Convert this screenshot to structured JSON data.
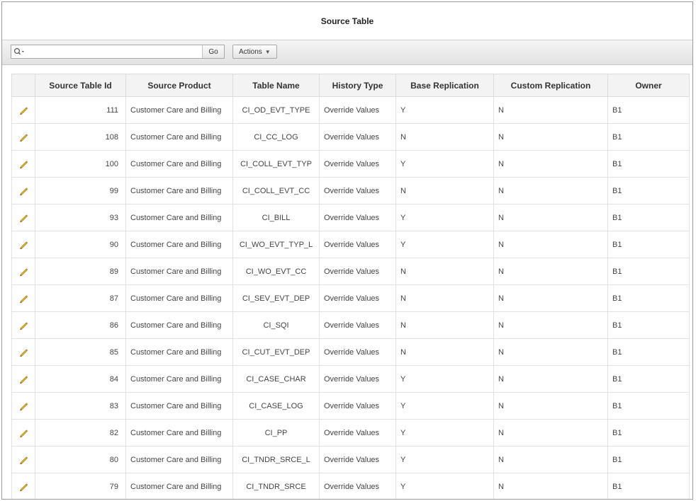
{
  "region": {
    "title": "Source Table"
  },
  "toolbar": {
    "search_value": "",
    "go_label": "Go",
    "actions_label": "Actions"
  },
  "icons": {
    "search": "search-icon",
    "edit": "pencil-icon",
    "caret": "chevron-down-icon"
  },
  "colors": {
    "toolbar_bg": "#e6e6e6",
    "header_bg": "#f3f3f3",
    "pencil": "#e3b72c"
  },
  "table": {
    "columns": [
      "Source Table Id",
      "Source Product",
      "Table Name",
      "History Type",
      "Base Replication",
      "Custom Replication",
      "Owner"
    ],
    "rows": [
      [
        "111",
        "Customer Care and Billing",
        "CI_OD_EVT_TYPE",
        "Override Values",
        "Y",
        "N",
        "B1"
      ],
      [
        "108",
        "Customer Care and Billing",
        "CI_CC_LOG",
        "Override Values",
        "N",
        "N",
        "B1"
      ],
      [
        "100",
        "Customer Care and Billing",
        "CI_COLL_EVT_TYP",
        "Override Values",
        "Y",
        "N",
        "B1"
      ],
      [
        "99",
        "Customer Care and Billing",
        "CI_COLL_EVT_CC",
        "Override Values",
        "N",
        "N",
        "B1"
      ],
      [
        "93",
        "Customer Care and Billing",
        "CI_BILL",
        "Override Values",
        "Y",
        "N",
        "B1"
      ],
      [
        "90",
        "Customer Care and Billing",
        "CI_WO_EVT_TYP_L",
        "Override Values",
        "Y",
        "N",
        "B1"
      ],
      [
        "89",
        "Customer Care and Billing",
        "CI_WO_EVT_CC",
        "Override Values",
        "N",
        "N",
        "B1"
      ],
      [
        "87",
        "Customer Care and Billing",
        "CI_SEV_EVT_DEP",
        "Override Values",
        "N",
        "N",
        "B1"
      ],
      [
        "86",
        "Customer Care and Billing",
        "CI_SQI",
        "Override Values",
        "N",
        "N",
        "B1"
      ],
      [
        "85",
        "Customer Care and Billing",
        "CI_CUT_EVT_DEP",
        "Override Values",
        "N",
        "N",
        "B1"
      ],
      [
        "84",
        "Customer Care and Billing",
        "CI_CASE_CHAR",
        "Override Values",
        "Y",
        "N",
        "B1"
      ],
      [
        "83",
        "Customer Care and Billing",
        "CI_CASE_LOG",
        "Override Values",
        "Y",
        "N",
        "B1"
      ],
      [
        "82",
        "Customer Care and Billing",
        "CI_PP",
        "Override Values",
        "Y",
        "N",
        "B1"
      ],
      [
        "80",
        "Customer Care and Billing",
        "CI_TNDR_SRCE_L",
        "Override Values",
        "Y",
        "N",
        "B1"
      ],
      [
        "79",
        "Customer Care and Billing",
        "CI_TNDR_SRCE",
        "Override Values",
        "Y",
        "N",
        "B1"
      ]
    ]
  }
}
